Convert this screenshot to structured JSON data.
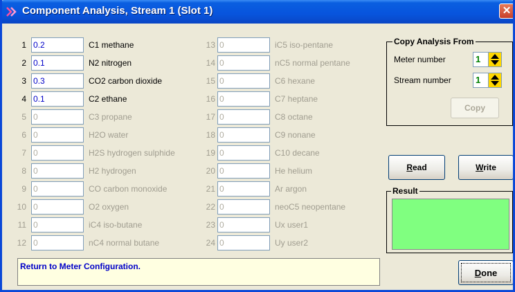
{
  "window": {
    "title": "Component Analysis, Stream 1 (Slot 1)",
    "close_label": "✕"
  },
  "components_left": [
    {
      "num": "1",
      "value": "0.2",
      "label": "C1 methane",
      "enabled": true
    },
    {
      "num": "2",
      "value": "0.1",
      "label": "N2 nitrogen",
      "enabled": true
    },
    {
      "num": "3",
      "value": "0.3",
      "label": "CO2 carbon dioxide",
      "enabled": true
    },
    {
      "num": "4",
      "value": "0.1",
      "label": "C2 ethane",
      "enabled": true
    },
    {
      "num": "5",
      "value": "0",
      "label": "C3 propane",
      "enabled": false
    },
    {
      "num": "6",
      "value": "0",
      "label": "H2O water",
      "enabled": false
    },
    {
      "num": "7",
      "value": "0",
      "label": "H2S hydrogen sulphide",
      "enabled": false
    },
    {
      "num": "8",
      "value": "0",
      "label": "H2 hydrogen",
      "enabled": false
    },
    {
      "num": "9",
      "value": "0",
      "label": "CO carbon monoxide",
      "enabled": false
    },
    {
      "num": "10",
      "value": "0",
      "label": "O2 oxygen",
      "enabled": false
    },
    {
      "num": "11",
      "value": "0",
      "label": "iC4 iso-butane",
      "enabled": false
    },
    {
      "num": "12",
      "value": "0",
      "label": "nC4 normal butane",
      "enabled": false
    }
  ],
  "components_right": [
    {
      "num": "13",
      "value": "0",
      "label": "iC5 iso-pentane",
      "enabled": false
    },
    {
      "num": "14",
      "value": "0",
      "label": "nC5 normal pentane",
      "enabled": false
    },
    {
      "num": "15",
      "value": "0",
      "label": "C6 hexane",
      "enabled": false
    },
    {
      "num": "16",
      "value": "0",
      "label": "C7 heptane",
      "enabled": false
    },
    {
      "num": "17",
      "value": "0",
      "label": "C8 octane",
      "enabled": false
    },
    {
      "num": "18",
      "value": "0",
      "label": "C9 nonane",
      "enabled": false
    },
    {
      "num": "19",
      "value": "0",
      "label": "C10 decane",
      "enabled": false
    },
    {
      "num": "20",
      "value": "0",
      "label": "He helium",
      "enabled": false
    },
    {
      "num": "21",
      "value": "0",
      "label": "Ar argon",
      "enabled": false
    },
    {
      "num": "22",
      "value": "0",
      "label": "neoC5 neopentane",
      "enabled": false
    },
    {
      "num": "23",
      "value": "0",
      "label": "Ux user1",
      "enabled": false
    },
    {
      "num": "24",
      "value": "0",
      "label": "Uy user2",
      "enabled": false
    }
  ],
  "copy_analysis": {
    "title": "Copy Analysis From",
    "meter_label": "Meter number",
    "meter_value": "1",
    "stream_label": "Stream number",
    "stream_value": "1",
    "copy_button": "Copy"
  },
  "buttons": {
    "read_u": "R",
    "read_rest": "ead",
    "write_u": "W",
    "write_rest": "rite",
    "done_u": "D",
    "done_rest": "one"
  },
  "result": {
    "title": "Result",
    "color": "#80ff80"
  },
  "status": {
    "text": "Return to Meter Configuration."
  },
  "colors": {
    "title_bar": "#0854dd",
    "value_text": "#0000c8",
    "spinner_value": "#008000",
    "spinner_arrows": "#ffd700",
    "status_bg": "#ffffe1"
  }
}
